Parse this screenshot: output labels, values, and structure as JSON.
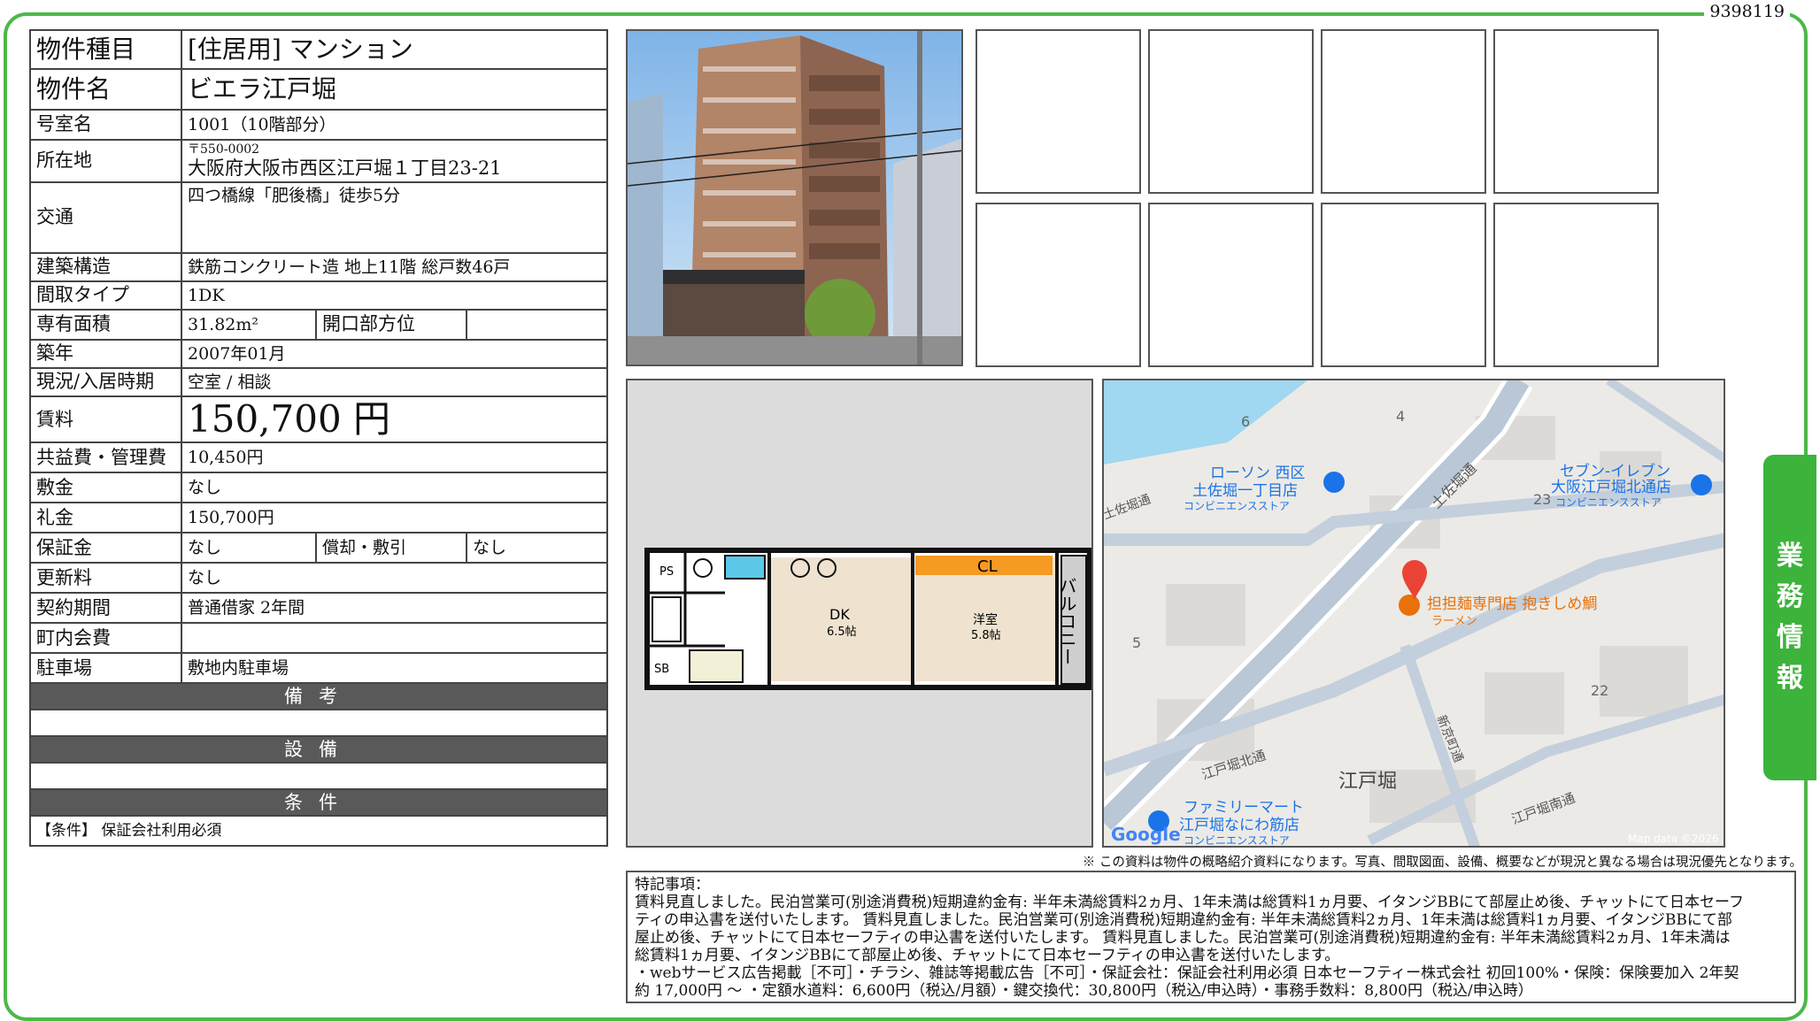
{
  "doc_id": "9398119",
  "property": {
    "type_label": "物件種目",
    "type_value": "[住居用] マンション",
    "name_label": "物件名",
    "name_value": "ビエラ江戸堀",
    "room_label": "号室名",
    "room_value": "1001（10階部分）",
    "location_label": "所在地",
    "zip": "〒550-0002",
    "address": "大阪府大阪市西区江戸堀１丁目23-21",
    "access_label": "交通",
    "access_value": "四つ橋線「肥後橋」徒歩5分",
    "structure_label": "建築構造",
    "structure_value": "鉄筋コンクリート造 地上11階 総戸数46戸",
    "layout_label": "間取タイプ",
    "layout_value": "1DK",
    "area_label": "専有面積",
    "area_value": "31.82m²",
    "orientation_label": "開口部方位",
    "orientation_value": "",
    "built_label": "築年",
    "built_value": "2007年01月",
    "status_label": "現況/入居時期",
    "status_value": "空室 / 相談",
    "rent_label": "賃料",
    "rent_value": "150,700 円",
    "fee_label": "共益費・管理費",
    "fee_value": "10,450円",
    "deposit_label": "敷金",
    "deposit_value": "なし",
    "keymoney_label": "礼金",
    "keymoney_value": "150,700円",
    "guarantee_label": "保証金",
    "guarantee_value": "なし",
    "amort_label": "償却・敷引",
    "amort_value": "なし",
    "renewal_label": "更新料",
    "renewal_value": "なし",
    "contract_label": "契約期間",
    "contract_value": "普通借家 2年間",
    "community_label": "町内会費",
    "community_value": "",
    "parking_label": "駐車場",
    "parking_value": "敷地内駐車場"
  },
  "sections": {
    "remarks": "備考",
    "equipment": "設備",
    "conditions": "条件",
    "conditions_text": "【条件】 保証会社利用必須"
  },
  "floorplan": {
    "ps": "PS",
    "cl": "CL",
    "sb": "SB",
    "balcony": "バルコニー",
    "dk": "DK",
    "dk_size": "6.5帖",
    "western": "洋室",
    "western_size": "5.8帖"
  },
  "map": {
    "lawson": "ローソン 西区",
    "lawson2": "土佐堀一丁目店",
    "lawson_cat": "コンビニエンスストア",
    "seven": "セブン-イレブン",
    "seven2": "大阪江戸堀北通店",
    "seven_cat": "コンビニエンスストア",
    "ramen": "担担麺専門店 抱きしめ鯛",
    "ramen_cat": "ラーメン",
    "family": "ファミリーマート",
    "family2": "江戸堀なにわ筋店",
    "family_cat": "コンビニエンスストア",
    "area": "江戸堀",
    "tosabori": "土佐堀通",
    "tosabori2": "土佐堀通",
    "edobori_kita": "江戸堀北通",
    "edobori_minami": "江戸堀南通",
    "street": "新京町通",
    "n4": "4",
    "n5": "5",
    "n6": "6",
    "n22": "22",
    "n23": "23",
    "google": "Google",
    "credit": "Map data ©2026"
  },
  "disclaimer": "※ この資料は物件の概略紹介資料になります。写真、間取図面、設備、概要などが現況と異なる場合は現況優先となります。",
  "notes": {
    "heading": "特記事項：",
    "line1": "賃料見直しました。民泊営業可(別途消費税)短期違約金有: 半年未満総賃料2ヵ月、1年未満は総賃料1ヵ月要、イタンジBBにて部屋止め後、チャットにて日本セーフ",
    "line2": "ティの申込書を送付いたします。 賃料見直しました。民泊営業可(別途消費税)短期違約金有: 半年未満総賃料2ヵ月、1年未満は総賃料1ヵ月要、イタンジBBにて部",
    "line3": "屋止め後、チャットにて日本セーフティの申込書を送付いたします。 賃料見直しました。民泊営業可(別途消費税)短期違約金有: 半年未満総賃料2ヵ月、1年未満は",
    "line4": "総賃料1ヵ月要、イタンジBBにて部屋止め後、チャットにて日本セーフティの申込書を送付いたします。",
    "line5": "・webサービス広告掲載［不可］・チラシ、雑誌等掲載広告［不可］・保証会社：保証会社利用必須 日本セーフティー株式会社 初回100%・保険：保険要加入 2年契",
    "line6": "約 17,000円 ～ ・定額水道料：6,600円（税込/月額）・鍵交換代：30,800円（税込/申込時）・事務手数料：8,800円（税込/申込時）"
  },
  "side_tab": [
    "業",
    "務",
    "情",
    "報"
  ],
  "colors": {
    "frame": "#4cb848",
    "tab": "#3cb33a",
    "section": "#595959"
  }
}
